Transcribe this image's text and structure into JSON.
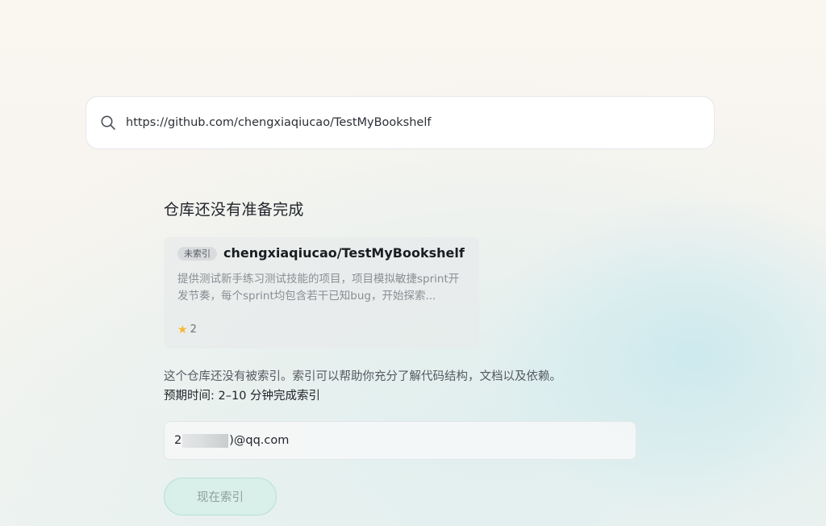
{
  "search": {
    "icon": "search-icon",
    "value": "https://github.com/chengxiaqiucao/TestMyBookshelf"
  },
  "main": {
    "title": "仓库还没有准备完成",
    "repo_card": {
      "badge": "未索引",
      "name": "chengxiaqiucao/TestMyBookshelf",
      "description": "提供测试新手练习测试技能的项目，项目模拟敏捷sprint开发节奏，每个sprint均包含若干已知bug，开始探索...",
      "star_icon": "star-icon",
      "stars": "2"
    },
    "info_text": "这个仓库还没有被索引。索引可以帮助你充分了解代码结构，文档以及依赖。",
    "eta_text": "预期时间: 2–10 分钟完成索引",
    "email": {
      "prefix": "2",
      "suffix": ")@qq.com"
    },
    "index_button_label": "现在索引"
  },
  "colors": {
    "accent_button_bg": "#d8efea",
    "accent_button_border": "#b6e0d6",
    "star": "#f5b82e"
  }
}
